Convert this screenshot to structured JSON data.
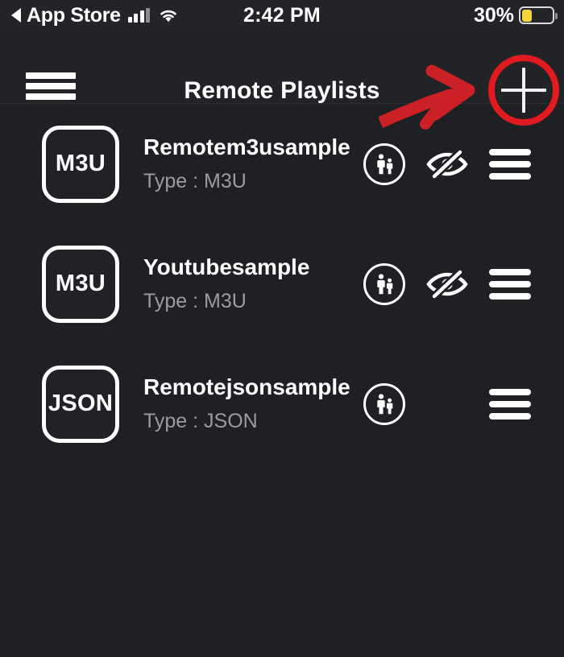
{
  "status_bar": {
    "back_label": "App Store",
    "back_icon": "back-triangle-icon",
    "signal_icon": "cellular-signal-icon",
    "wifi_icon": "wifi-icon",
    "time": "2:42 PM",
    "battery_percent": "30%",
    "battery_level": 30,
    "battery_icon": "battery-low-power-icon",
    "battery_color": "#f5d33a"
  },
  "header": {
    "menu_icon": "hamburger-menu-icon",
    "title": "Remote Playlists",
    "add_icon": "plus-icon",
    "annotation": {
      "arrow_icon": "red-arrow-annotation",
      "circle_icon": "red-circle-annotation",
      "color": "#e01b20"
    }
  },
  "playlists": [
    {
      "badge": "M3U",
      "name": "Remotem3usample",
      "type_label": "Type : M3U",
      "parental_icon": "parental-control-icon",
      "hidden_icon": "eye-slash-icon",
      "has_hidden_icon": true,
      "menu_icon": "list-menu-icon"
    },
    {
      "badge": "M3U",
      "name": "Youtubesample",
      "type_label": "Type : M3U",
      "parental_icon": "parental-control-icon",
      "hidden_icon": "eye-slash-icon",
      "has_hidden_icon": true,
      "menu_icon": "list-menu-icon"
    },
    {
      "badge": "JSON",
      "name": "Remotejsonsample",
      "type_label": "Type : JSON",
      "parental_icon": "parental-control-icon",
      "hidden_icon": "",
      "has_hidden_icon": false,
      "menu_icon": "list-menu-icon"
    }
  ],
  "theme": {
    "background": "#1e2024",
    "header_background": "#212327",
    "text_primary": "#ffffff",
    "text_secondary": "#9a9c9f",
    "accent_red": "#e01b20"
  }
}
